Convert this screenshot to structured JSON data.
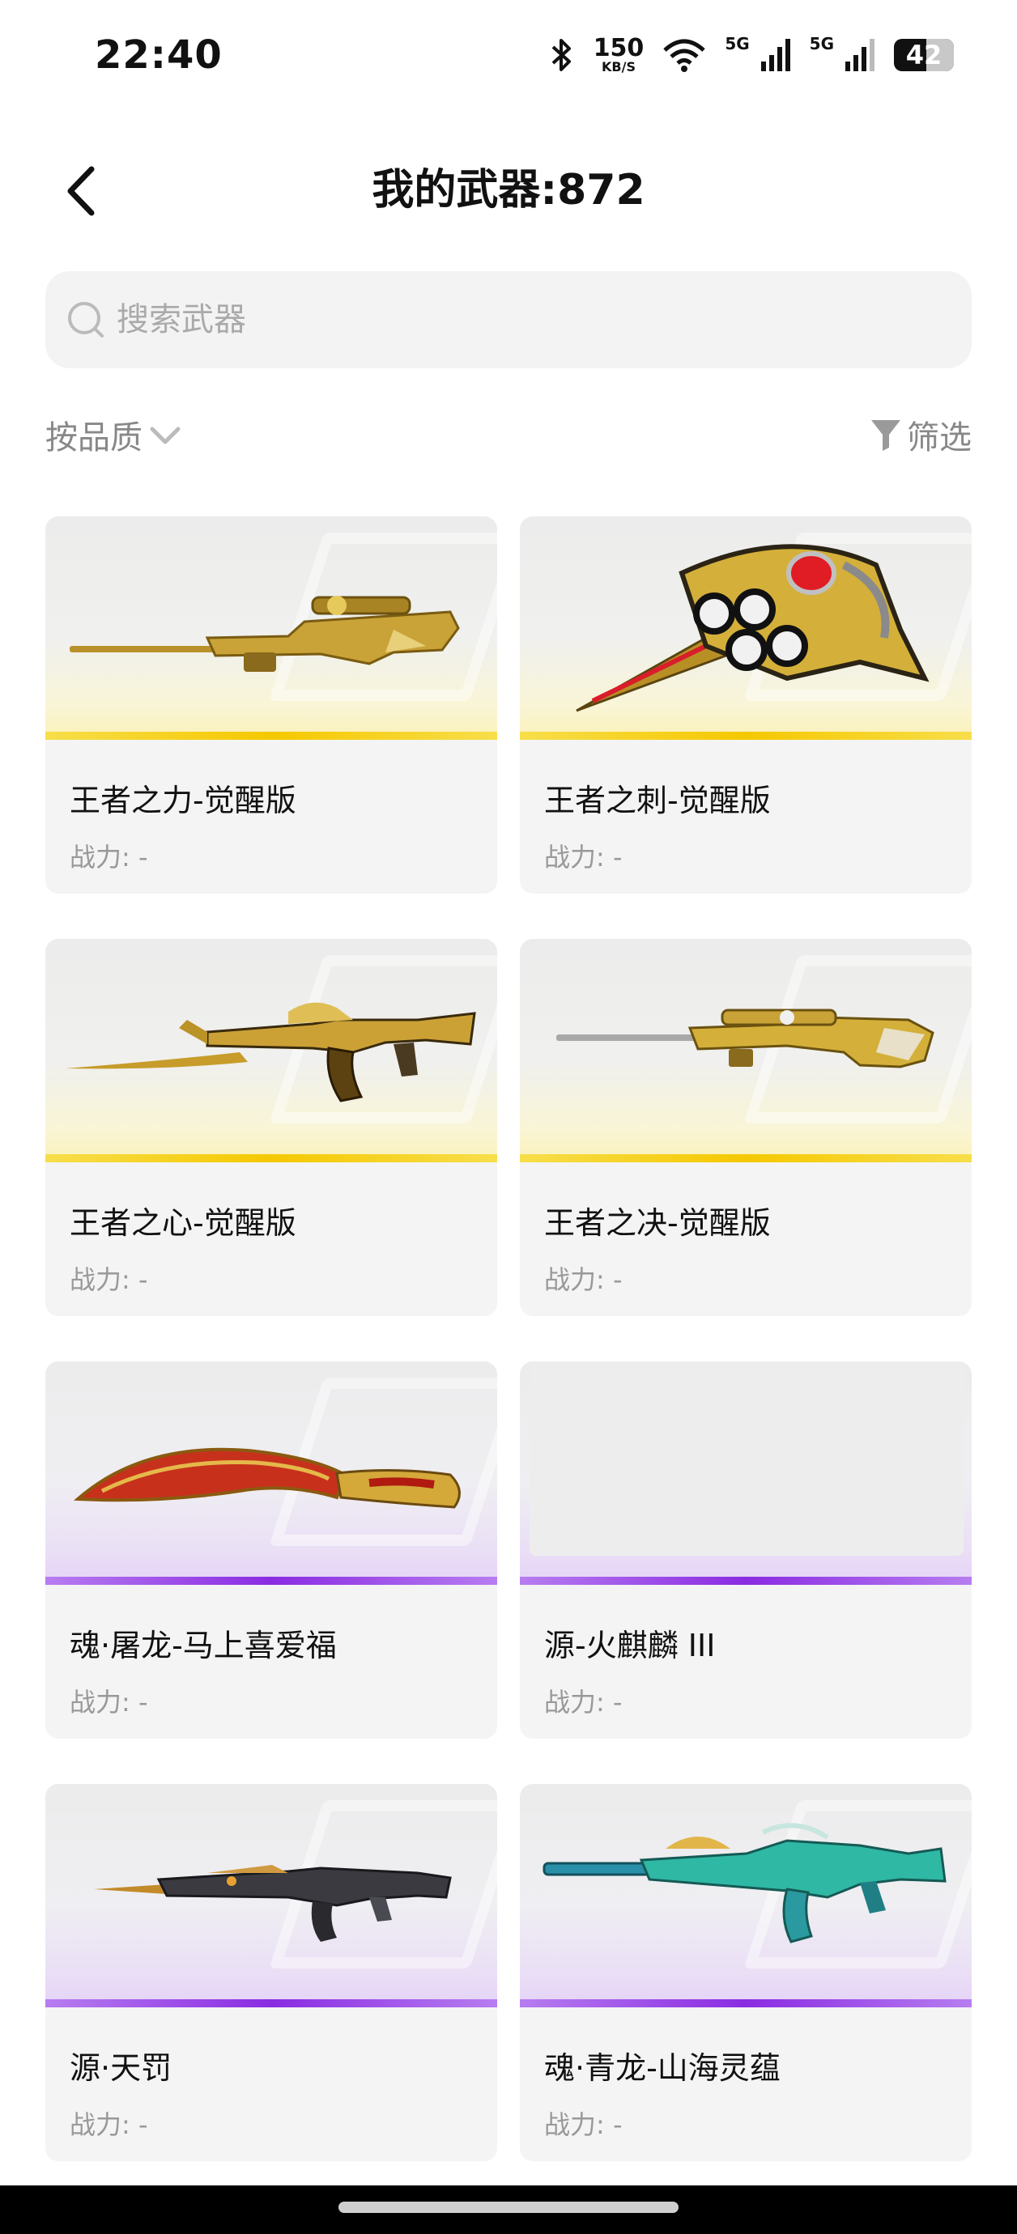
{
  "status_bar": {
    "time": "22:40",
    "speed_value": "150",
    "speed_unit": "KB/S",
    "net1": "5G",
    "net2": "5G",
    "battery": "42",
    "icons": [
      "bluetooth-icon",
      "wifi-icon",
      "signal-icon",
      "signal-icon",
      "battery-icon"
    ]
  },
  "header": {
    "title": "我的武器:872",
    "back_icon": "chevron-left-icon"
  },
  "search": {
    "placeholder": "搜索武器",
    "value": ""
  },
  "toolbar": {
    "sort_label": "按品质",
    "filter_label": "筛选"
  },
  "colors": {
    "gold_quality": "#f5c800",
    "purple_quality": "#8a2be2",
    "card_bg": "#f4f4f4"
  },
  "weapons": [
    {
      "name": "王者之力-觉醒版",
      "power": "战力: -",
      "quality": "gold"
    },
    {
      "name": "王者之刺-觉醒版",
      "power": "战力: -",
      "quality": "gold"
    },
    {
      "name": "王者之心-觉醒版",
      "power": "战力: -",
      "quality": "gold"
    },
    {
      "name": "王者之决-觉醒版",
      "power": "战力: -",
      "quality": "gold"
    },
    {
      "name": "魂·屠龙-马上喜爱福",
      "power": "战力: -",
      "quality": "purple"
    },
    {
      "name": "源-火麒麟 III",
      "power": "战力: -",
      "quality": "purple"
    },
    {
      "name": "源·天罚",
      "power": "战力: -",
      "quality": "purple"
    },
    {
      "name": "魂·青龙-山海灵蕴",
      "power": "战力: -",
      "quality": "purple"
    }
  ]
}
